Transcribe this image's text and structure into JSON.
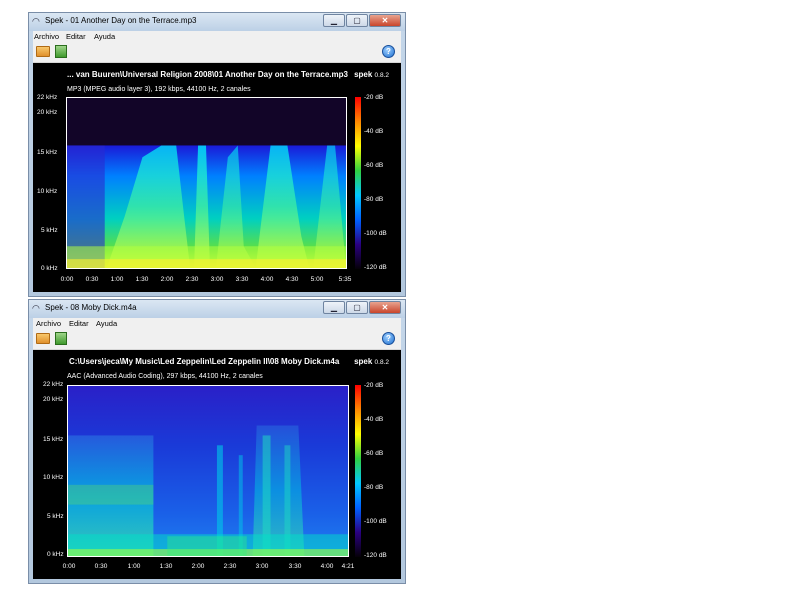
{
  "windows": [
    {
      "title": "Spek - 01 Another Day on the Terrace.mp3",
      "menu": [
        "Archivo",
        "Editar",
        "Ayuda"
      ],
      "file_title": "... van Buuren\\Universal Religion 2008\\01 Another Day on the Terrace.mp3",
      "file_info": "MP3 (MPEG audio layer 3), 192 kbps, 44100 Hz, 2 canales",
      "brand": "spek",
      "version": "0.8.2",
      "freq_ticks": [
        "22 kHz",
        "20 kHz",
        "15 kHz",
        "10 kHz",
        "5 kHz",
        "0 kHz"
      ],
      "time_ticks": [
        "0:00",
        "0:30",
        "1:00",
        "1:30",
        "2:00",
        "2:30",
        "3:00",
        "3:30",
        "4:00",
        "4:30",
        "5:00",
        "5:35"
      ],
      "db_ticks": [
        "-20 dB",
        "-40 dB",
        "-60 dB",
        "-80 dB",
        "-100 dB",
        "-120 dB"
      ]
    },
    {
      "title": "Spek - 08 Moby Dick.m4a",
      "menu": [
        "Archivo",
        "Editar",
        "Ayuda"
      ],
      "file_title": "C:\\Users\\jeca\\My Music\\Led Zeppelin\\Led Zeppelin II\\08 Moby Dick.m4a",
      "file_info": "AAC (Advanced Audio Coding), 297 kbps, 44100 Hz, 2 canales",
      "brand": "spek",
      "version": "0.8.2",
      "freq_ticks": [
        "22 kHz",
        "20 kHz",
        "15 kHz",
        "10 kHz",
        "5 kHz",
        "0 kHz"
      ],
      "time_ticks": [
        "0:00",
        "0:30",
        "1:00",
        "1:30",
        "2:00",
        "2:30",
        "3:00",
        "3:30",
        "4:00",
        "4:21"
      ],
      "db_ticks": [
        "-20 dB",
        "-40 dB",
        "-60 dB",
        "-80 dB",
        "-100 dB",
        "-120 dB"
      ]
    }
  ],
  "icons": {
    "app": "spek-app-icon",
    "open": "open-folder-icon",
    "save": "save-icon",
    "help": "help-icon"
  },
  "colors": {
    "plot_background": "#000000",
    "titlebar": "#bcd0e6",
    "close_button": "#c9452b"
  }
}
